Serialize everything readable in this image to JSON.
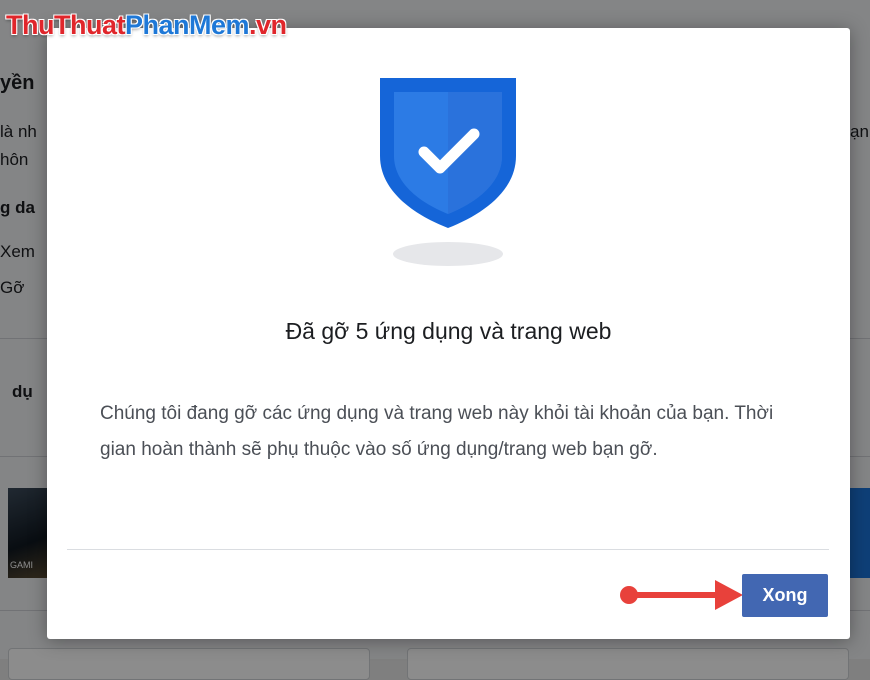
{
  "watermark": {
    "part1": "ThuThuat",
    "part2": "PhanMem",
    "part3": ".vn"
  },
  "background": {
    "heading": "yền",
    "line1": "là nh",
    "line2": "hôn",
    "subheading": "g da",
    "view": "Xem",
    "remove": "Gỡ",
    "section": "dụ",
    "right_text": "ạn",
    "thumb_label": "GAMI"
  },
  "dialog": {
    "icon": "shield-check-icon",
    "title": "Đã gỡ 5 ứng dụng và trang web",
    "body": "Chúng tôi đang gỡ các ứng dụng và trang web này khỏi tài khoản của bạn. Thời gian hoàn thành sẽ phụ thuộc vào số ứng dụng/trang web bạn gỡ.",
    "done_label": "Xong"
  },
  "colors": {
    "accent": "#4267b2",
    "shield_dark": "#1565d8",
    "shield_light": "#2c7be5",
    "arrow": "#e8413b"
  }
}
